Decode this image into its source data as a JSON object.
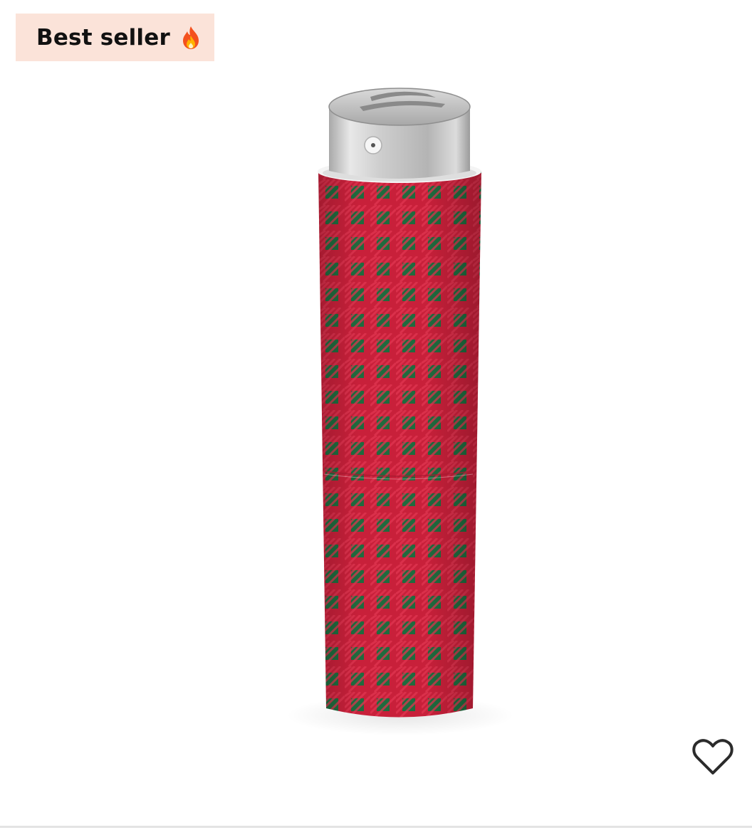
{
  "badge": {
    "label": "Best seller",
    "icon": "fire-icon",
    "background": "#fbe3d9"
  },
  "product": {
    "image_icon": "perfume-atomizer-icon",
    "pattern_colors": {
      "red": "#c8203a",
      "green": "#1f6b3e",
      "cap": "#c0c0c0"
    }
  },
  "favorite": {
    "icon": "heart-outline-icon"
  }
}
